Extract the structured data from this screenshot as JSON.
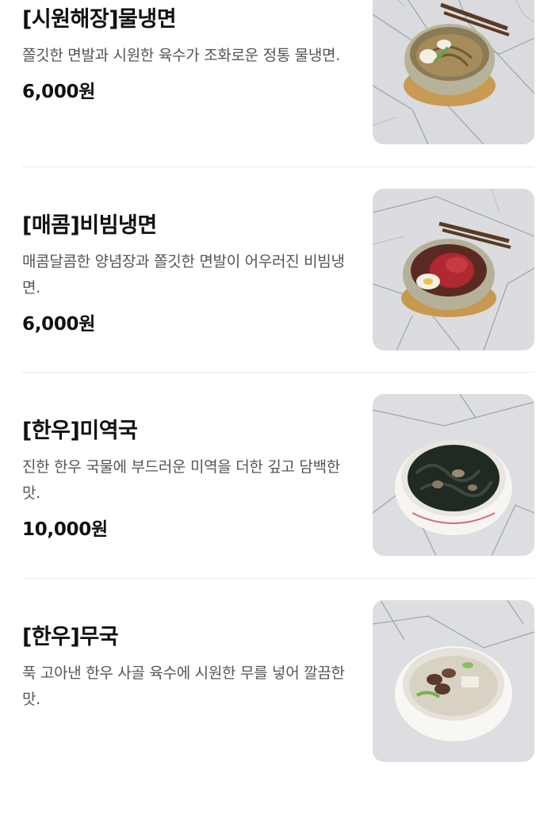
{
  "menu": {
    "items": [
      {
        "name": "[시원해장]물냉면",
        "description": "쫄깃한 면발과 시원한 육수가 조화로운 정통 물냉면.",
        "price": "6,000원",
        "image": "naengmyeon-bowl-photo"
      },
      {
        "name": "[매콤]비빔냉면",
        "description": "매콤달콤한 양념장과 쫄깃한 면발이 어우러진 비빔냉면.",
        "price": "6,000원",
        "image": "bibim-naengmyeon-bowl-photo"
      },
      {
        "name": "[한우]미역국",
        "description": "진한 한우 국물에 부드러운 미역을 더한 깊고 담백한 맛.",
        "price": "10,000원",
        "image": "seaweed-soup-bowl-photo"
      },
      {
        "name": "[한우]무국",
        "description": "푹 고아낸 한우 사골 육수에 시원한 무를 넣어 깔끔한 맛.",
        "price": "",
        "image": "radish-soup-bowl-photo"
      }
    ]
  }
}
